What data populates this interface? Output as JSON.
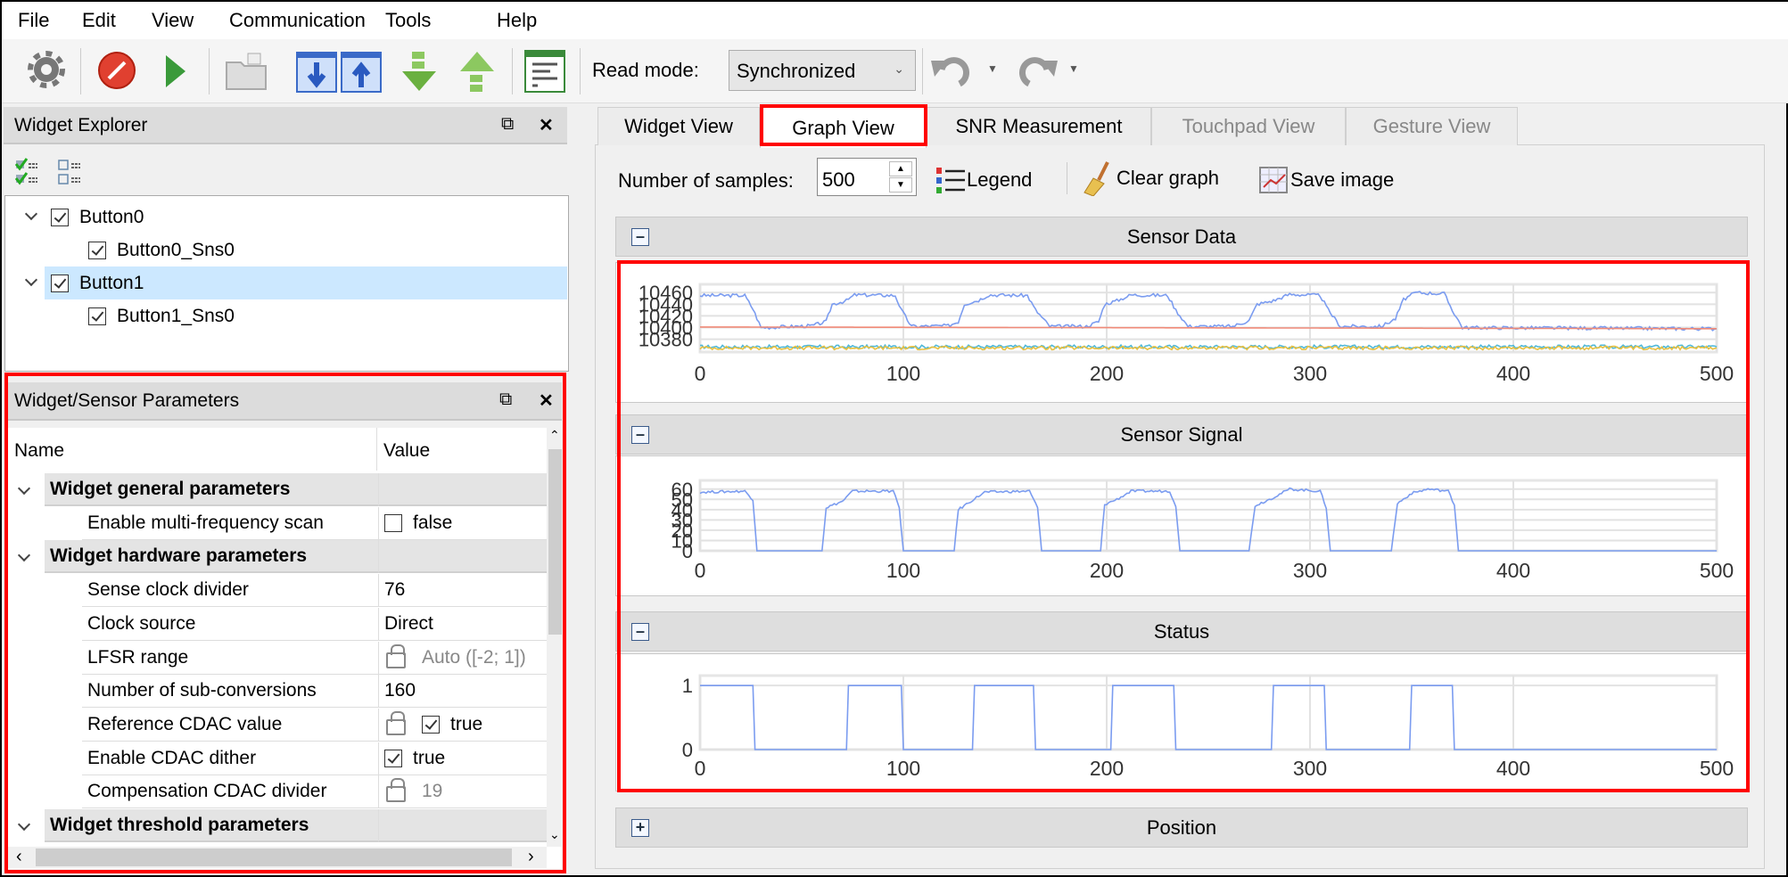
{
  "menu": [
    "File",
    "Edit",
    "View",
    "Communication",
    "Tools",
    "Help"
  ],
  "toolbar": {
    "icons": [
      "gear-icon",
      "stop-icon",
      "play-icon",
      "open-folder-icon",
      "download-icon",
      "upload-icon",
      "read-down-icon",
      "write-up-icon",
      "log-icon"
    ],
    "read_mode_label": "Read mode:",
    "read_mode_value": "Synchronized"
  },
  "widget_explorer": {
    "title": "Widget Explorer",
    "tree": [
      {
        "label": "Button0",
        "checked": true,
        "children": [
          {
            "label": "Button0_Sns0",
            "checked": true
          }
        ]
      },
      {
        "label": "Button1",
        "checked": true,
        "selected": true,
        "children": [
          {
            "label": "Button1_Sns0",
            "checked": true
          }
        ]
      }
    ]
  },
  "parameters": {
    "title": "Widget/Sensor Parameters",
    "col_name": "Name",
    "col_value": "Value",
    "rows": [
      {
        "group": true,
        "name": "Widget general parameters"
      },
      {
        "name": "Enable multi-frequency scan",
        "value": "false",
        "checkbox": false
      },
      {
        "group": true,
        "name": "Widget hardware parameters"
      },
      {
        "name": "Sense clock divider",
        "value": "76"
      },
      {
        "name": "Clock source",
        "value": "Direct"
      },
      {
        "name": "LFSR range",
        "value": "Auto ([-2; 1])",
        "locked": true
      },
      {
        "name": "Number of sub-conversions",
        "value": "160"
      },
      {
        "name": "Reference CDAC value",
        "value": "true",
        "locked": true,
        "checkbox": true
      },
      {
        "name": "Enable CDAC dither",
        "value": "true",
        "checkbox": true
      },
      {
        "name": "Compensation CDAC divider",
        "value": "19",
        "locked": true
      },
      {
        "group": true,
        "name": "Widget threshold parameters"
      }
    ]
  },
  "tabs": [
    {
      "label": "Widget View",
      "state": "normal"
    },
    {
      "label": "Graph View",
      "state": "active"
    },
    {
      "label": "SNR Measurement",
      "state": "normal"
    },
    {
      "label": "Touchpad View",
      "state": "disabled"
    },
    {
      "label": "Gesture View",
      "state": "disabled"
    }
  ],
  "graph_toolbar": {
    "samples_label": "Number of samples:",
    "samples_value": "500",
    "legend": "Legend",
    "clear": "Clear graph",
    "save": "Save image"
  },
  "sections": {
    "sensor_data": "Sensor Data",
    "sensor_signal": "Sensor Signal",
    "status": "Status",
    "position": "Position"
  },
  "colors": {
    "highlight": "#f00000",
    "selection": "#cce8ff",
    "raw": "#7b9cf0",
    "baseline": "#f08a78",
    "noise1": "#4fb8d8",
    "noise2": "#e8c040"
  },
  "chart_data": [
    {
      "type": "line",
      "title": "Sensor Data",
      "xlim": [
        0,
        500
      ],
      "ylim": [
        10358,
        10468
      ],
      "xticks": [
        0,
        100,
        200,
        300,
        400,
        500
      ],
      "yticks": [
        10380,
        10400,
        10420,
        10440,
        10460
      ],
      "grid": true,
      "series": [
        {
          "color": "#7b9cf0",
          "points": [
            [
              0,
              10455
            ],
            [
              22,
              10455
            ],
            [
              26,
              10432
            ],
            [
              30,
              10400
            ],
            [
              55,
              10403
            ],
            [
              62,
              10410
            ],
            [
              65,
              10440
            ],
            [
              72,
              10446
            ],
            [
              76,
              10456
            ],
            [
              96,
              10455
            ],
            [
              99,
              10430
            ],
            [
              104,
              10402
            ],
            [
              122,
              10403
            ],
            [
              127,
              10410
            ],
            [
              130,
              10440
            ],
            [
              137,
              10447
            ],
            [
              142,
              10456
            ],
            [
              161,
              10455
            ],
            [
              165,
              10430
            ],
            [
              172,
              10402
            ],
            [
              190,
              10402
            ],
            [
              196,
              10410
            ],
            [
              199,
              10440
            ],
            [
              205,
              10446
            ],
            [
              212,
              10456
            ],
            [
              230,
              10455
            ],
            [
              234,
              10430
            ],
            [
              240,
              10402
            ],
            [
              262,
              10402
            ],
            [
              270,
              10412
            ],
            [
              274,
              10440
            ],
            [
              282,
              10446
            ],
            [
              290,
              10457
            ],
            [
              305,
              10455
            ],
            [
              309,
              10430
            ],
            [
              315,
              10402
            ],
            [
              335,
              10402
            ],
            [
              342,
              10415
            ],
            [
              346,
              10448
            ],
            [
              352,
              10460
            ],
            [
              366,
              10458
            ],
            [
              370,
              10430
            ],
            [
              375,
              10400
            ],
            [
              500,
              10398
            ]
          ]
        },
        {
          "color": "#f08a78",
          "points": [
            [
              0,
              10401
            ],
            [
              500,
              10398
            ]
          ]
        },
        {
          "color": "#4fb8d8",
          "points": [
            [
              0,
              10367
            ],
            [
              500,
              10367
            ]
          ]
        },
        {
          "color": "#e8c040",
          "points": [
            [
              0,
              10365
            ],
            [
              500,
              10365
            ]
          ]
        }
      ]
    },
    {
      "type": "line",
      "title": "Sensor Signal",
      "xlim": [
        0,
        500
      ],
      "ylim": [
        0,
        65
      ],
      "xticks": [
        0,
        100,
        200,
        300,
        400,
        500
      ],
      "yticks": [
        0,
        10,
        20,
        30,
        40,
        50,
        60
      ],
      "grid": true,
      "series": [
        {
          "color": "#7b9cf0",
          "points": [
            [
              0,
              57
            ],
            [
              22,
              58
            ],
            [
              26,
              50
            ],
            [
              28,
              0
            ],
            [
              60,
              0
            ],
            [
              62,
              42
            ],
            [
              70,
              48
            ],
            [
              75,
              58
            ],
            [
              95,
              58
            ],
            [
              98,
              42
            ],
            [
              100,
              0
            ],
            [
              125,
              0
            ],
            [
              127,
              40
            ],
            [
              133,
              48
            ],
            [
              140,
              57
            ],
            [
              162,
              58
            ],
            [
              166,
              42
            ],
            [
              168,
              0
            ],
            [
              197,
              0
            ],
            [
              199,
              45
            ],
            [
              205,
              50
            ],
            [
              212,
              58
            ],
            [
              231,
              58
            ],
            [
              234,
              44
            ],
            [
              236,
              0
            ],
            [
              270,
              0
            ],
            [
              273,
              44
            ],
            [
              280,
              50
            ],
            [
              290,
              60
            ],
            [
              305,
              58
            ],
            [
              308,
              42
            ],
            [
              310,
              0
            ],
            [
              340,
              0
            ],
            [
              343,
              46
            ],
            [
              350,
              56
            ],
            [
              358,
              60
            ],
            [
              368,
              58
            ],
            [
              371,
              45
            ],
            [
              373,
              0
            ],
            [
              500,
              0
            ]
          ]
        }
      ]
    },
    {
      "type": "line",
      "title": "Status",
      "xlim": [
        0,
        500
      ],
      "ylim": [
        0,
        1.1
      ],
      "xticks": [
        0,
        100,
        200,
        300,
        400,
        500
      ],
      "yticks": [
        0,
        1
      ],
      "grid": true,
      "series": [
        {
          "color": "#7b9cf0",
          "points": [
            [
              0,
              1
            ],
            [
              26,
              1
            ],
            [
              27,
              0
            ],
            [
              72,
              0
            ],
            [
              73,
              1
            ],
            [
              99,
              1
            ],
            [
              100,
              0
            ],
            [
              134,
              0
            ],
            [
              135,
              1
            ],
            [
              164,
              1
            ],
            [
              165,
              0
            ],
            [
              202,
              0
            ],
            [
              203,
              1
            ],
            [
              233,
              1
            ],
            [
              234,
              0
            ],
            [
              281,
              0
            ],
            [
              282,
              1
            ],
            [
              307,
              1
            ],
            [
              308,
              0
            ],
            [
              349,
              0
            ],
            [
              350,
              1
            ],
            [
              370,
              1
            ],
            [
              371,
              0
            ],
            [
              500,
              0
            ]
          ]
        }
      ]
    }
  ]
}
